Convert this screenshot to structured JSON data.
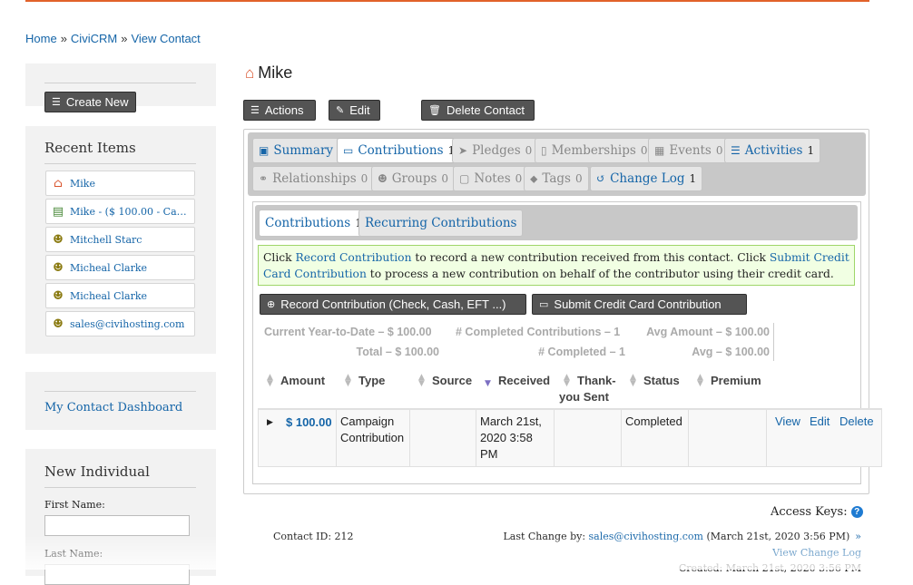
{
  "breadcrumb": {
    "home": "Home",
    "sep": "»",
    "civicrm": "CiviCRM",
    "view_contact": "View Contact"
  },
  "sidebar": {
    "create_new": "Create New",
    "recent_title": "Recent Items",
    "recent_items": [
      {
        "label": "Mike",
        "icon": "house-icon"
      },
      {
        "label": "Mike - ($ 100.00 - Campa...",
        "icon": "contribution-icon"
      },
      {
        "label": "Mitchell Starc",
        "icon": "person-icon"
      },
      {
        "label": "Micheal Clarke",
        "icon": "person-icon"
      },
      {
        "label": "Micheal Clarke",
        "icon": "person-icon"
      },
      {
        "label": "sales@civihosting.com",
        "icon": "person-icon"
      }
    ],
    "dashboard_link": "My Contact Dashboard",
    "new_individual_title": "New Individual",
    "first_name_label": "First Name:",
    "last_name_label": "Last Name:"
  },
  "contact": {
    "name": "Mike"
  },
  "actions": {
    "actions": "Actions",
    "edit": "Edit",
    "delete": "Delete Contact"
  },
  "tabs": [
    {
      "label": "Summary",
      "count": "",
      "icon": "id-card-icon",
      "state": "link"
    },
    {
      "label": "Contributions",
      "count": "1",
      "icon": "credit-card-icon",
      "state": "active"
    },
    {
      "label": "Pledges",
      "count": "0",
      "icon": "paper-plane-icon",
      "state": "disabled"
    },
    {
      "label": "Memberships",
      "count": "0",
      "icon": "id-badge-icon",
      "state": "disabled"
    },
    {
      "label": "Events",
      "count": "0",
      "icon": "calendar-icon",
      "state": "disabled"
    },
    {
      "label": "Activities",
      "count": "1",
      "icon": "list-icon",
      "state": "link"
    },
    {
      "label": "Relationships",
      "count": "0",
      "icon": "handshake-icon",
      "state": "disabled"
    },
    {
      "label": "Groups",
      "count": "0",
      "icon": "users-icon",
      "state": "disabled"
    },
    {
      "label": "Notes",
      "count": "0",
      "icon": "note-icon",
      "state": "disabled"
    },
    {
      "label": "Tags",
      "count": "0",
      "icon": "tags-icon",
      "state": "disabled"
    },
    {
      "label": "Change Log",
      "count": "1",
      "icon": "history-icon",
      "state": "link"
    }
  ],
  "subtabs": [
    {
      "label": "Contributions",
      "count": "1"
    },
    {
      "label": "Recurring Contributions",
      "count": ""
    }
  ],
  "help": {
    "t1": "Click ",
    "link1": "Record Contribution",
    "t2": " to record a new contribution received from this contact. Click ",
    "link2": "Submit Credit Card Contribution",
    "t3": " to process a new contribution on behalf of the contributor using their credit card."
  },
  "buttons": {
    "record": "Record Contribution (Check, Cash, EFT ...)",
    "submit_cc": "Submit Credit Card Contribution"
  },
  "summary": {
    "ytd": "Current Year-to-Date – $ 100.00",
    "total": "Total – $ 100.00",
    "completed_contribs": "# Completed Contributions – 1",
    "completed": "# Completed – 1",
    "avg_amount": "Avg Amount – $ 100.00",
    "avg": "Avg – $ 100.00"
  },
  "table": {
    "headers": [
      "Amount",
      "Type",
      "Source",
      "Received",
      "Thank-you Sent",
      "Status",
      "Premium"
    ],
    "row": {
      "amount": "$ 100.00",
      "type": "Campaign Contribution",
      "source": "",
      "received": "March 21st, 2020 3:58 PM",
      "thankyou": "",
      "status": "Completed",
      "premium": "",
      "view": "View",
      "edit": "Edit",
      "delete": "Delete"
    }
  },
  "footer": {
    "access_keys": "Access Keys:",
    "contact_id": "Contact ID: 212",
    "last_change_prefix": "Last Change by: ",
    "last_change_user": "sales@civihosting.com",
    "last_change_date": " (March 21st, 2020 3:56 PM)",
    "arrow": "»",
    "view_change_log": "View Change Log",
    "created": "Created: March 21st, 2020 3:56 PM"
  },
  "colors": {
    "link": "#1565a8",
    "accent_bar": "#e2622a",
    "help_bg": "#f1ffe3"
  }
}
